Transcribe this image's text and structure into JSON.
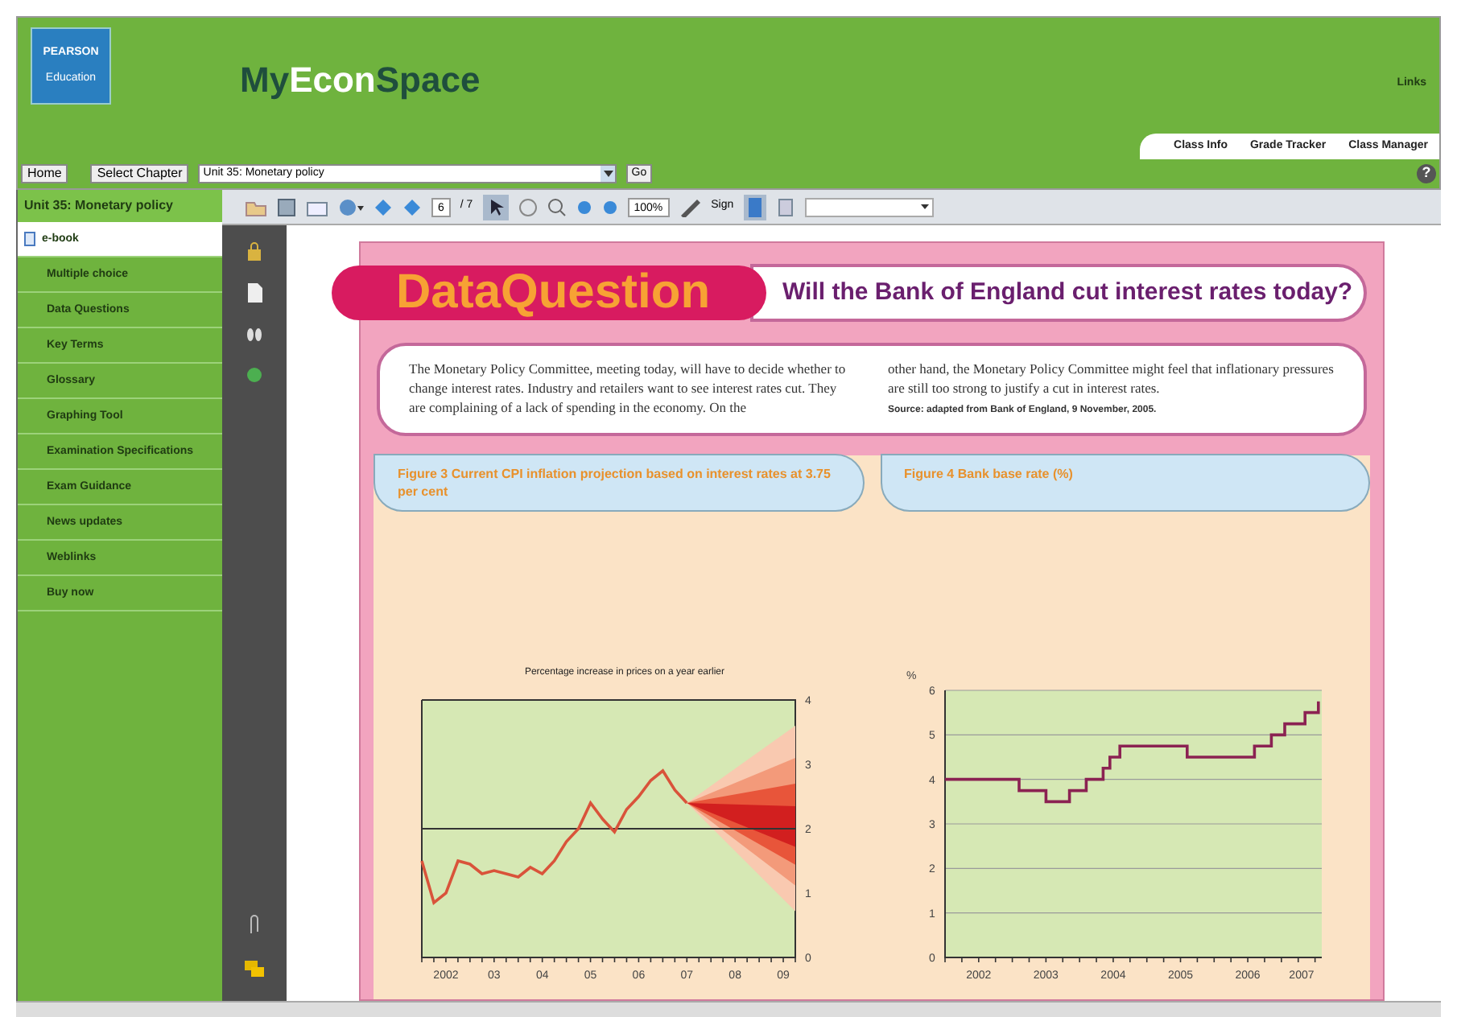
{
  "header": {
    "logo": [
      "PEARSON",
      "Education"
    ],
    "brand": [
      {
        "text": "My",
        "highlight": false
      },
      {
        "text": "Econ",
        "highlight": true
      },
      {
        "text": "Space",
        "highlight": false
      }
    ],
    "links": [
      "Links"
    ]
  },
  "nav": {
    "home": "Home",
    "select_chapter": "Select Chapter",
    "chapter": "Unit 35: Monetary policy",
    "go": "Go",
    "help": "?"
  },
  "tabs": [
    {
      "label": "Class Info",
      "selected": false
    },
    {
      "label": "Grade Tracker",
      "selected": false
    },
    {
      "label": "Class Manager",
      "selected": false
    }
  ],
  "sidebar": {
    "title": "Unit 35: Monetary policy",
    "items": [
      {
        "label": "e-book",
        "selected": true
      },
      {
        "label": "Multiple choice",
        "selected": false
      },
      {
        "label": "Data Questions",
        "selected": false
      },
      {
        "label": "Key Terms",
        "selected": false
      },
      {
        "label": "Glossary",
        "selected": false
      },
      {
        "label": "Graphing Tool",
        "selected": false
      },
      {
        "label": "Examination Specifications",
        "selected": false
      },
      {
        "label": "Exam Guidance",
        "selected": false
      },
      {
        "label": "News updates",
        "selected": false
      },
      {
        "label": "Weblinks",
        "selected": false
      },
      {
        "label": "Buy now",
        "selected": false
      }
    ]
  },
  "toolbar": {
    "page": "6",
    "pages": "/ 7",
    "zoom": "100%",
    "sign": "Sign"
  },
  "document": {
    "badge": "DataQuestion",
    "title": "Will the Bank of England cut interest rates today?",
    "text_left": "The Monetary Policy Committee, meeting today, will have to decide whether to change interest rates. Industry and retailers want to see interest rates cut. They are complaining of a lack of spending in the economy. On the",
    "text_right": "other hand, the Monetary Policy Committee might feel that inflationary pressures are still too strong to justify a cut in interest rates.",
    "source": "Source: adapted from Bank of England, 9 November, 2005.",
    "figures": [
      {
        "caption": "Figure 3 Current CPI inflation projection based on interest rates at 3.75 per cent",
        "chart_data": {
          "type": "line",
          "title": "Percentage increase in prices on a year earlier",
          "categories": [
            null,
            null,
            "2002",
            null,
            null,
            null,
            "03",
            null,
            null,
            null,
            "04",
            null,
            null,
            null,
            "05",
            null,
            null,
            null,
            "06",
            null,
            null,
            null,
            "07",
            null,
            null,
            null,
            "08",
            null,
            null,
            null,
            "09",
            null
          ],
          "series": [
            {
              "color": "#d9533a",
              "values": [
                1.5,
                0.85,
                1.0,
                1.5,
                1.45,
                1.3,
                1.35,
                1.3,
                1.25,
                1.4,
                1.3,
                1.5,
                1.8,
                2.0,
                2.4,
                2.15,
                1.95,
                2.3,
                2.5,
                2.75,
                2.9,
                2.6,
                2.4,
                null,
                null,
                null,
                null,
                null,
                null,
                null,
                null,
                null
              ]
            }
          ],
          "ylim": [
            0,
            4
          ],
          "yticks": [
            0,
            1,
            2,
            3,
            4
          ],
          "ref_lines": [
            {
              "axis": "y",
              "value": 2
            }
          ]
        }
      },
      {
        "caption": "Figure 4 Bank base rate (%)",
        "chart_data": {
          "type": "line",
          "ylabel": "%",
          "x": [
            2002,
            2003.1,
            2003.1,
            2003.5,
            2003.5,
            2003.85,
            2003.85,
            2004.1,
            2004.1,
            2004.35,
            2004.35,
            2004.45,
            2004.45,
            2004.6,
            2004.6,
            2005.6,
            2005.6,
            2006.6,
            2006.6,
            2006.85,
            2006.85,
            2007.05,
            2007.05,
            2007.35,
            2007.35,
            2007.55,
            2007.55
          ],
          "series": [
            {
              "color": "#8b2252",
              "values": [
                4,
                4,
                3.75,
                3.75,
                3.5,
                3.5,
                3.75,
                3.75,
                4,
                4,
                4.25,
                4.25,
                4.5,
                4.5,
                4.75,
                4.75,
                4.5,
                4.5,
                4.75,
                4.75,
                5,
                5,
                5.25,
                5.25,
                5.5,
                5.5,
                5.75
              ]
            }
          ],
          "xlim": [
            2002,
            2007.6
          ],
          "ylim": [
            0,
            6
          ],
          "xticks": [
            {
              "value": 2002.5,
              "label": "2002"
            },
            {
              "value": 2003.5,
              "label": "2003"
            },
            {
              "value": 2004.5,
              "label": "2004"
            },
            {
              "value": 2005.5,
              "label": "2005"
            },
            {
              "value": 2006.5,
              "label": "2006"
            },
            {
              "value": 2007.3,
              "label": "2007"
            }
          ],
          "yticks": [
            0,
            1,
            2,
            3,
            4,
            5,
            6
          ],
          "grid": true
        }
      }
    ]
  }
}
